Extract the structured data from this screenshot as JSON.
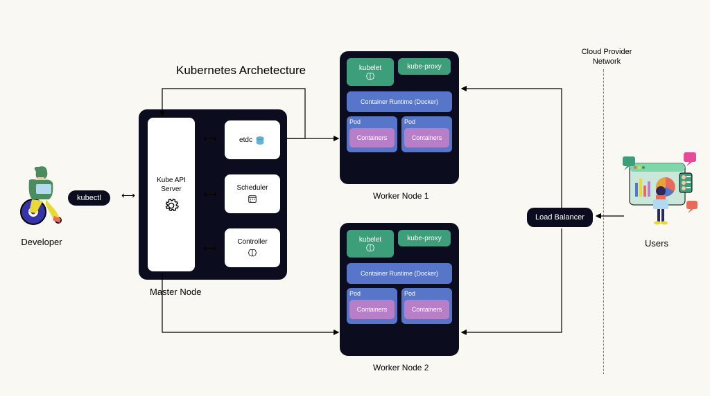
{
  "title": "Kubernetes Archetecture",
  "developer_label": "Developer",
  "kubectl": "kubectl",
  "master": {
    "label": "Master Node",
    "api_server": "Kube API Server",
    "etcd": "etdc",
    "scheduler": "Scheduler",
    "controller": "Controller"
  },
  "worker": {
    "kubelet": "kubelet",
    "kube_proxy": "kube-proxy",
    "runtime": "Container Runtime (Docker)",
    "pod": "Pod",
    "containers": "Containers",
    "label1": "Worker Node 1",
    "label2": "Worker Node 2"
  },
  "load_balancer": "Load Balancer",
  "cloud_network": "Cloud Provider Network",
  "users_label": "Users",
  "colors": {
    "dark": "#0b0d1f",
    "green": "#3d9e7a",
    "blue": "#5876c9",
    "purple": "#b87fc9",
    "bg": "#faf8f3"
  }
}
